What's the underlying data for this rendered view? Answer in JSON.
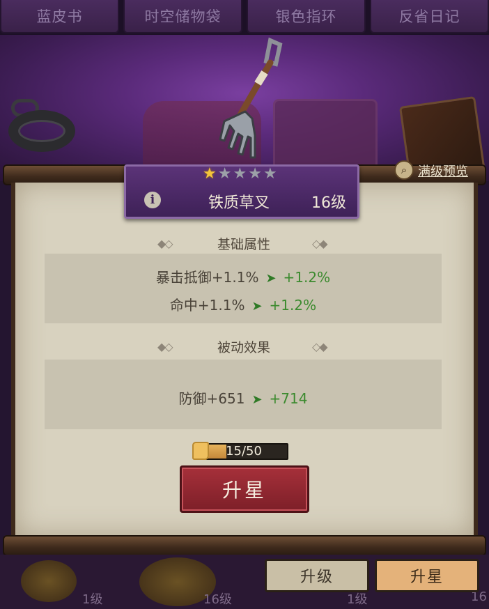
{
  "tabs": [
    "蓝皮书",
    "时空储物袋",
    "银色指环",
    "反省日记"
  ],
  "item": {
    "name": "铁质草叉",
    "level": "16级",
    "stars_filled": 1,
    "stars_total": 5
  },
  "preview_label": "满级预览",
  "base_attributes": {
    "heading": "基础属性",
    "rows": [
      {
        "current": "暴击抵御+1.1%",
        "next": "+1.2%"
      },
      {
        "current": "命中+1.1%",
        "next": "+1.2%"
      }
    ]
  },
  "passive_effects": {
    "heading": "被动效果",
    "rows": [
      {
        "current": "防御+651",
        "next": "+714"
      }
    ]
  },
  "progress": {
    "text": "15/50",
    "current": 15,
    "max": 50
  },
  "star_up_button": "升星",
  "bottom": {
    "level_left": "1级",
    "level_mid": "16级",
    "level_right": "1级",
    "level_far": "16",
    "btn_level": "升级",
    "btn_starup": "升星"
  },
  "colors": {
    "accent_purple": "#5b3378",
    "button_red": "#a6303a",
    "upgrade_green": "#3b8a2e",
    "star_gold": "#f3c43b"
  }
}
